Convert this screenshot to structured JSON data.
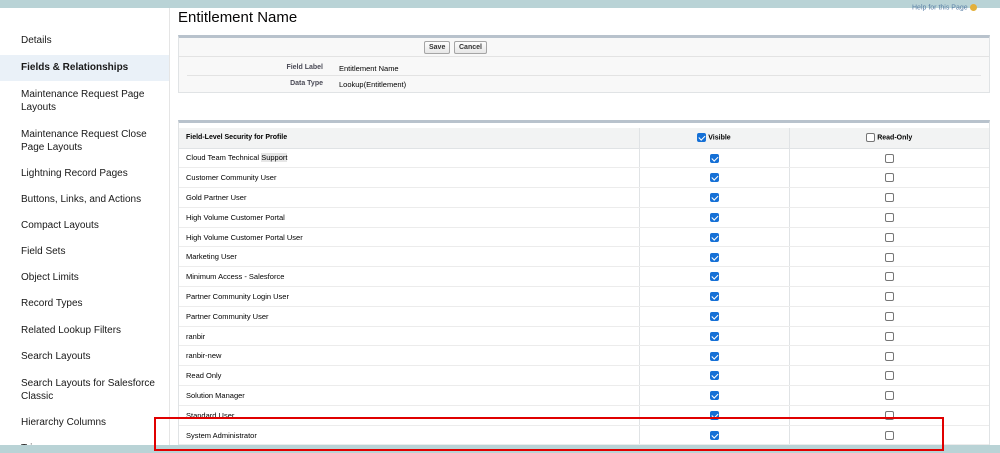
{
  "page": {
    "title": "Entitlement Name",
    "top_right_link": "Help for this Page"
  },
  "sidebar": {
    "items": [
      {
        "label": "Details",
        "active": false
      },
      {
        "label": "Fields & Relationships",
        "active": true
      },
      {
        "label": "Maintenance Request Page Layouts",
        "active": false
      },
      {
        "label": "Maintenance Request Close Page Layouts",
        "active": false
      },
      {
        "label": "Lightning Record Pages",
        "active": false
      },
      {
        "label": "Buttons, Links, and Actions",
        "active": false
      },
      {
        "label": "Compact Layouts",
        "active": false
      },
      {
        "label": "Field Sets",
        "active": false
      },
      {
        "label": "Object Limits",
        "active": false
      },
      {
        "label": "Record Types",
        "active": false
      },
      {
        "label": "Related Lookup Filters",
        "active": false
      },
      {
        "label": "Search Layouts",
        "active": false
      },
      {
        "label": "Search Layouts for Salesforce Classic",
        "active": false
      },
      {
        "label": "Hierarchy Columns",
        "active": false
      },
      {
        "label": "Triggers",
        "active": false
      }
    ]
  },
  "toolbar": {
    "save_label": "Save",
    "cancel_label": "Cancel"
  },
  "field_info": {
    "field_label_label": "Field Label",
    "field_label_value": "Entitlement Name",
    "data_type_label": "Data Type",
    "data_type_value": "Lookup(Entitlement)"
  },
  "fls": {
    "header_profile": "Field-Level Security for Profile",
    "header_visible": "Visible",
    "header_readonly": "Read-Only",
    "header_visible_checked": true,
    "header_readonly_checked": false,
    "rows": [
      {
        "profile": "Cloud Team Technical ",
        "profile_hl": "Support",
        "visible": true,
        "read_only": false
      },
      {
        "profile": "Customer Community User",
        "profile_hl": "",
        "visible": true,
        "read_only": false
      },
      {
        "profile": "Gold Partner User",
        "profile_hl": "",
        "visible": true,
        "read_only": false
      },
      {
        "profile": "High Volume Customer Portal",
        "profile_hl": "",
        "visible": true,
        "read_only": false
      },
      {
        "profile": "High Volume Customer Portal User",
        "profile_hl": "",
        "visible": true,
        "read_only": false
      },
      {
        "profile": "Marketing User",
        "profile_hl": "",
        "visible": true,
        "read_only": false
      },
      {
        "profile": "Minimum Access - Salesforce",
        "profile_hl": "",
        "visible": true,
        "read_only": false
      },
      {
        "profile": "Partner Community Login User",
        "profile_hl": "",
        "visible": true,
        "read_only": false
      },
      {
        "profile": "Partner Community User",
        "profile_hl": "",
        "visible": true,
        "read_only": false
      },
      {
        "profile": "ranbir",
        "profile_hl": "",
        "visible": true,
        "read_only": false
      },
      {
        "profile": "ranbir-new",
        "profile_hl": "",
        "visible": true,
        "read_only": false
      },
      {
        "profile": "Read Only",
        "profile_hl": "",
        "visible": true,
        "read_only": false
      },
      {
        "profile": "Solution Manager",
        "profile_hl": "",
        "visible": true,
        "read_only": false
      },
      {
        "profile": "Standard User",
        "profile_hl": "",
        "visible": true,
        "read_only": false
      },
      {
        "profile": "System Administrator",
        "profile_hl": "",
        "visible": true,
        "read_only": false
      }
    ]
  },
  "colors": {
    "checkbox_blue": "#1570d6",
    "highlight_red": "#e00000",
    "active_nav_bg": "#eaf1f8"
  }
}
